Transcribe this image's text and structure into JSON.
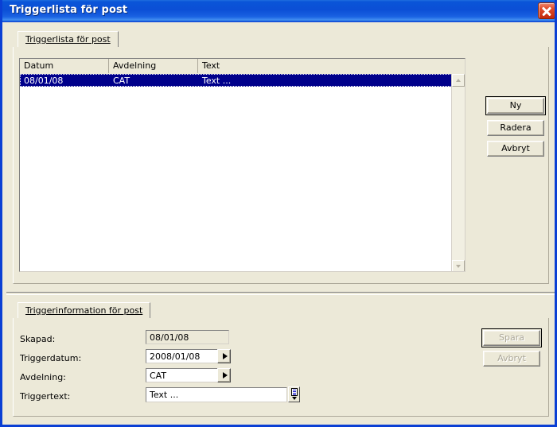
{
  "window": {
    "title": "Triggerlista för post",
    "close_icon": "close-icon"
  },
  "top_panel": {
    "tab_label": "Triggerlista för post",
    "list": {
      "columns": [
        "Datum",
        "Avdelning",
        "Text"
      ],
      "rows": [
        {
          "datum": "08/01/08",
          "avdelning": "CAT",
          "text": "Text ...",
          "selected": true
        }
      ]
    },
    "scrollbar": {
      "up_icon": "scroll-up-arrow-icon",
      "down_icon": "scroll-down-arrow-icon"
    },
    "buttons": {
      "new": "Ny",
      "delete": "Radera",
      "cancel": "Avbryt"
    }
  },
  "bottom_panel": {
    "tab_label": "Triggerinformation för post",
    "fields": {
      "created_label": "Skapad:",
      "created_value": "08/01/08",
      "trigger_date_label": "Triggerdatum:",
      "trigger_date_value": "2008/01/08",
      "department_label": "Avdelning:",
      "department_value": "CAT",
      "trigger_text_label": "Triggertext:",
      "trigger_text_value": "Text ..."
    },
    "icons": {
      "date_dropdown": "dropdown-arrow-icon",
      "department_dropdown": "dropdown-arrow-icon",
      "memo": "memo-list-icon"
    },
    "buttons": {
      "save": "Spara",
      "cancel": "Avbryt"
    }
  },
  "colors": {
    "titlebar_blue": "#0b4fd6",
    "window_border": "#0a3fd4",
    "face": "#ece9d8",
    "selection": "#00008b",
    "close_red": "#c2290d",
    "disabled_text": "#aca899"
  }
}
